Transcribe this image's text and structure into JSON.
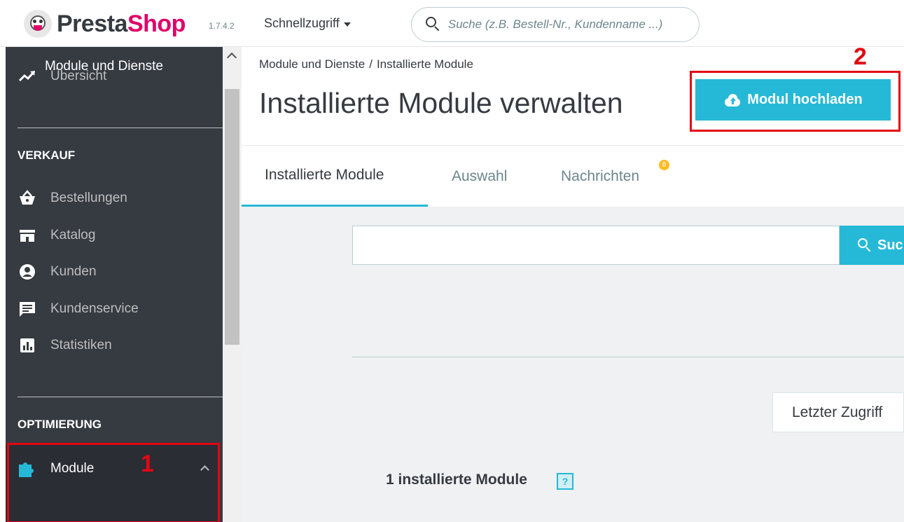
{
  "topbar": {
    "logo_part1": "Presta",
    "logo_part2": "Shop",
    "version": "1.7.4.2",
    "quick_access": "Schnellzugriff",
    "search_placeholder": "Suche (z.B. Bestell-Nr., Kundenname ...)"
  },
  "sidebar": {
    "overview": "Übersicht",
    "section_sales": "VERKAUF",
    "sales_items": [
      "Bestellungen",
      "Katalog",
      "Kunden",
      "Kundenservice",
      "Statistiken"
    ],
    "section_optimization": "OPTIMIERUNG",
    "modules": "Module",
    "modules_sub": "Module und Dienste"
  },
  "annotations": {
    "marker_1": "1",
    "marker_2": "2",
    "marker_color": "#e30613"
  },
  "header": {
    "breadcrumb_parent": "Module und Dienste",
    "breadcrumb_sep": "/",
    "breadcrumb_current": "Installierte Module",
    "title": "Installierte Module verwalten",
    "upload_button": "Modul hochladen"
  },
  "tabs": [
    {
      "label": "Installierte Module",
      "active": true
    },
    {
      "label": "Auswahl",
      "active": false
    },
    {
      "label": "Nachrichten",
      "active": false,
      "badge": "8"
    }
  ],
  "main": {
    "search_button": "Suche",
    "sort_button": "Letzter Zugriff",
    "installed_count": "1 installierte Module",
    "help_icon_text": "?"
  },
  "colors": {
    "accent": "#25b9d7",
    "sidebar_bg": "#363a41",
    "brand_pink": "#df0067",
    "badge": "#fbbb22"
  }
}
